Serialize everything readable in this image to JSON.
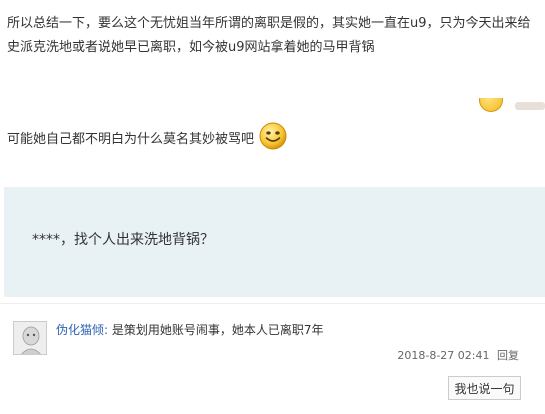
{
  "post": {
    "paragraph_line1": "所以总结一下，要么这个无忧姐当年所谓的离职是假的，其实她一直在u9，只为今天出来给",
    "paragraph_line2": "史派克洗地或者说她早已离职，如今被u9网站拿着她的马甲背锅",
    "line2": "可能她自己都不明白为什么莫名其妙被骂吧",
    "smiley_icon": "smiley-emoji-icon"
  },
  "quote": {
    "text": "****，找个人出来洗地背锅？"
  },
  "reply": {
    "username": "伪化猫倾:",
    "content": " 是策划用她账号闹事，她本人已离职7年",
    "timestamp": "2018-8-27 02:41",
    "reply_label": "回复",
    "say_button": "我也说一句"
  },
  "colors": {
    "quote_bg": "#e8f1f4",
    "username": "#2d64b3",
    "text": "#333333"
  }
}
